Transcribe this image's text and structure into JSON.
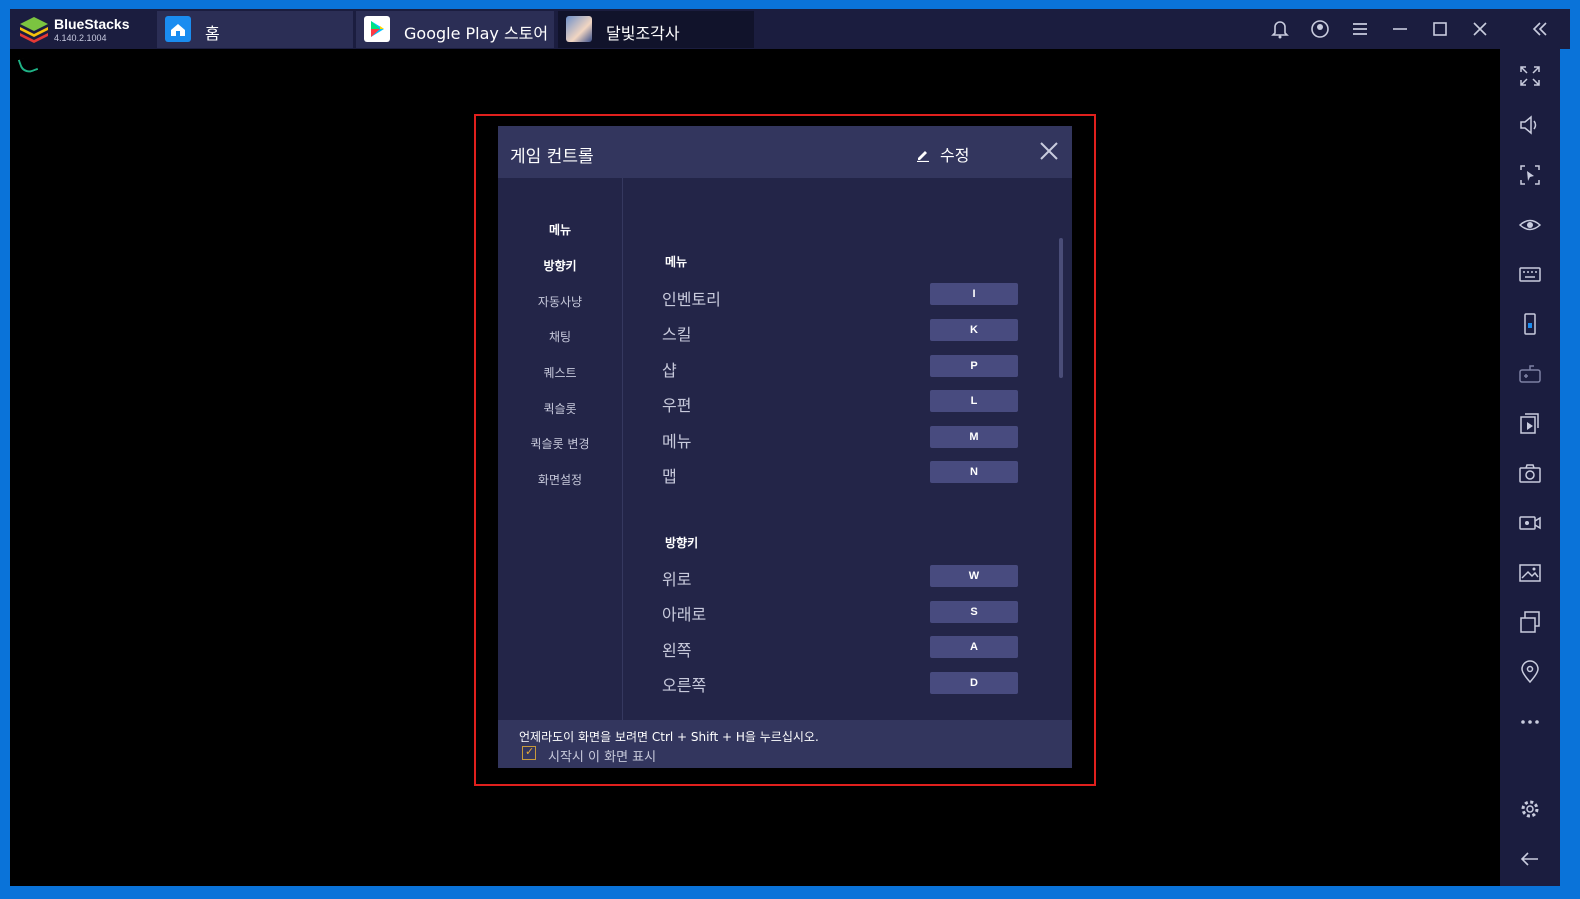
{
  "app": {
    "name": "BlueStacks",
    "version": "4.140.2.1004"
  },
  "tabs": [
    {
      "label": "홈",
      "icon": "home-icon"
    },
    {
      "label": "Google Play 스토어",
      "icon": "google-play-icon"
    },
    {
      "label": "달빛조각사",
      "icon": "game-icon"
    }
  ],
  "dialog": {
    "title": "게임 컨트롤",
    "edit_label": "수정",
    "nav": [
      "메뉴",
      "방향키",
      "자동사냥",
      "채팅",
      "퀘스트",
      "퀵슬롯",
      "퀵슬롯 변경",
      "화면설정"
    ],
    "sections": [
      {
        "title": "메뉴",
        "rows": [
          {
            "label": "인벤토리",
            "key": "I"
          },
          {
            "label": "스킬",
            "key": "K"
          },
          {
            "label": "샵",
            "key": "P"
          },
          {
            "label": "우편",
            "key": "L"
          },
          {
            "label": "메뉴",
            "key": "M"
          },
          {
            "label": "맵",
            "key": "N"
          }
        ]
      },
      {
        "title": "방향키",
        "rows": [
          {
            "label": "위로",
            "key": "W"
          },
          {
            "label": "아래로",
            "key": "S"
          },
          {
            "label": "왼쪽",
            "key": "A"
          },
          {
            "label": "오른쪽",
            "key": "D"
          }
        ]
      }
    ],
    "footer_hint": "언제라도이 화면을 보려면 Ctrl + Shift + H을 누르십시오.",
    "footer_checkbox": "시작시 이 화면 표시"
  },
  "colors": {
    "accent_blue": "#0a73d9",
    "highlight_red": "#e0201d",
    "dialog_bg": "#232548"
  }
}
